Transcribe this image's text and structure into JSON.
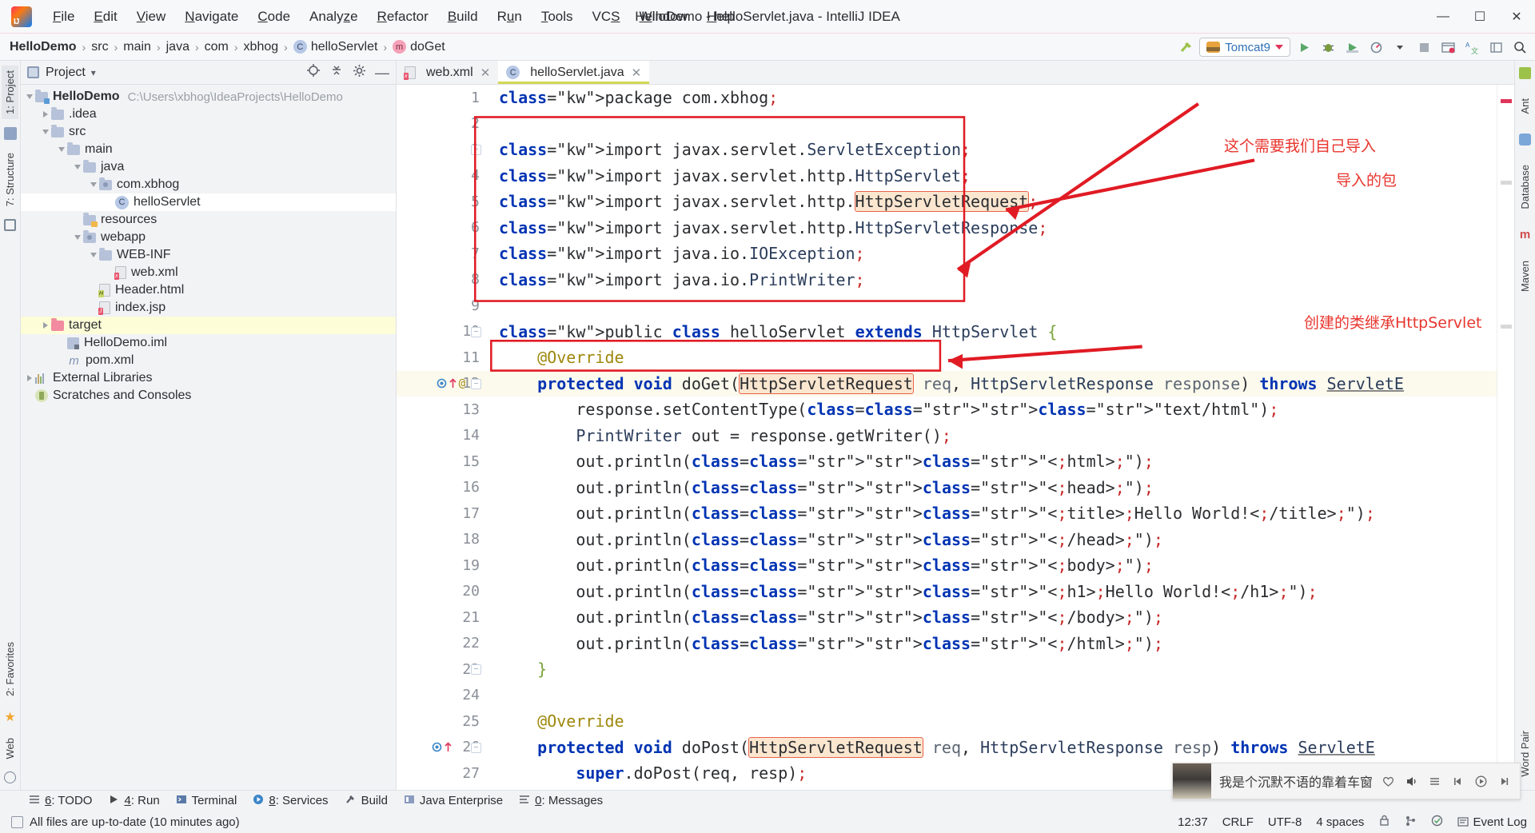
{
  "window": {
    "title": "HelloDemo - helloServlet.java - IntelliJ IDEA",
    "minimize": "—",
    "maximize": "❐",
    "close": "✕"
  },
  "menubar": {
    "items": [
      {
        "label": "File",
        "mnemonic": "F"
      },
      {
        "label": "Edit",
        "mnemonic": "E"
      },
      {
        "label": "View",
        "mnemonic": "V"
      },
      {
        "label": "Navigate",
        "mnemonic": "N"
      },
      {
        "label": "Code",
        "mnemonic": "C"
      },
      {
        "label": "Analyze",
        "mnemonic": "z"
      },
      {
        "label": "Refactor",
        "mnemonic": "R"
      },
      {
        "label": "Build",
        "mnemonic": "B"
      },
      {
        "label": "Run",
        "mnemonic": "u"
      },
      {
        "label": "Tools",
        "mnemonic": "T"
      },
      {
        "label": "VCS",
        "mnemonic": "S"
      },
      {
        "label": "Window",
        "mnemonic": "W"
      },
      {
        "label": "Help",
        "mnemonic": "H"
      }
    ]
  },
  "breadcrumb": {
    "separator": "›",
    "items": [
      {
        "label": "HelloDemo",
        "bold": true,
        "icon": ""
      },
      {
        "label": "src",
        "bold": false,
        "icon": ""
      },
      {
        "label": "main",
        "bold": false,
        "icon": ""
      },
      {
        "label": "java",
        "bold": false,
        "icon": ""
      },
      {
        "label": "com",
        "bold": false,
        "icon": ""
      },
      {
        "label": "xbhog",
        "bold": false,
        "icon": ""
      },
      {
        "label": "helloServlet",
        "bold": false,
        "icon": "class-icon",
        "icon_letter": "C"
      },
      {
        "label": "doGet",
        "bold": false,
        "icon": "method-icon",
        "icon_letter": "m"
      }
    ]
  },
  "toolbar": {
    "run_config": "Tomcat9",
    "run_label": "run-button",
    "debug_label": "debug-button",
    "coverage_label": "run-with-coverage-button",
    "profile_label": "profiler-button",
    "stop_label": "stop-button",
    "updates_label": "updates-button",
    "translate_label": "translate-button",
    "layout_label": "layout-button",
    "search_label": "search-everywhere-button"
  },
  "left_rail": {
    "tabs": [
      {
        "label": "1: Project",
        "selected": true
      },
      {
        "label": "7: Structure",
        "selected": false
      },
      {
        "label": "2: Favorites",
        "selected": false
      },
      {
        "label": "Web",
        "selected": false
      }
    ]
  },
  "right_rail": {
    "tabs": [
      {
        "label": "Ant"
      },
      {
        "label": "Database"
      },
      {
        "label": "Maven"
      },
      {
        "label": "Word Pair"
      }
    ]
  },
  "project_panel": {
    "title": "Project",
    "dropdown_caret": "▾",
    "tree": [
      {
        "depth": 0,
        "arrow": "open",
        "icon": "module-folder-icon",
        "label": "HelloDemo",
        "bold": true,
        "path": "C:\\Users\\xbhog\\IdeaProjects\\HelloDemo",
        "state": "normal"
      },
      {
        "depth": 1,
        "arrow": "closed",
        "icon": "folder-icon",
        "label": ".idea",
        "bold": false,
        "path": "",
        "state": "normal"
      },
      {
        "depth": 1,
        "arrow": "open",
        "icon": "folder-icon",
        "label": "src",
        "bold": false,
        "path": "",
        "state": "normal"
      },
      {
        "depth": 2,
        "arrow": "open",
        "icon": "folder-icon",
        "label": "main",
        "bold": false,
        "path": "",
        "state": "normal"
      },
      {
        "depth": 3,
        "arrow": "open",
        "icon": "folder-source-icon",
        "label": "java",
        "bold": false,
        "path": "",
        "state": "normal"
      },
      {
        "depth": 4,
        "arrow": "open",
        "icon": "package-icon",
        "label": "com.xbhog",
        "bold": false,
        "path": "",
        "state": "normal"
      },
      {
        "depth": 5,
        "arrow": "none",
        "icon": "class-icon",
        "label": "helloServlet",
        "bold": false,
        "path": "",
        "state": "selected"
      },
      {
        "depth": 3,
        "arrow": "none",
        "icon": "folder-resource-icon",
        "label": "resources",
        "bold": false,
        "path": "",
        "state": "normal"
      },
      {
        "depth": 3,
        "arrow": "open",
        "icon": "folder-webapp-icon",
        "label": "webapp",
        "bold": false,
        "path": "",
        "state": "normal"
      },
      {
        "depth": 4,
        "arrow": "open",
        "icon": "folder-icon",
        "label": "WEB-INF",
        "bold": false,
        "path": "",
        "state": "normal"
      },
      {
        "depth": 5,
        "arrow": "none",
        "icon": "xml-file-icon",
        "label": "web.xml",
        "bold": false,
        "path": "",
        "state": "normal"
      },
      {
        "depth": 4,
        "arrow": "none",
        "icon": "html-file-icon",
        "label": "Header.html",
        "bold": false,
        "path": "",
        "state": "normal"
      },
      {
        "depth": 4,
        "arrow": "none",
        "icon": "jsp-file-icon",
        "label": "index.jsp",
        "bold": false,
        "path": "",
        "state": "normal"
      },
      {
        "depth": 1,
        "arrow": "closed",
        "icon": "target-folder-icon",
        "label": "target",
        "bold": false,
        "path": "",
        "state": "highlight"
      },
      {
        "depth": 2,
        "arrow": "none",
        "icon": "iml-file-icon",
        "label": "HelloDemo.iml",
        "bold": false,
        "path": "",
        "state": "normal"
      },
      {
        "depth": 2,
        "arrow": "none",
        "icon": "maven-file-icon",
        "label": "pom.xml",
        "bold": false,
        "path": "",
        "state": "normal"
      },
      {
        "depth": 0,
        "arrow": "closed",
        "icon": "libraries-icon",
        "label": "External Libraries",
        "bold": false,
        "path": "",
        "state": "normal"
      },
      {
        "depth": 0,
        "arrow": "none",
        "icon": "scratches-icon",
        "label": "Scratches and Consoles",
        "bold": false,
        "path": "",
        "state": "normal"
      }
    ]
  },
  "editor": {
    "tabs": [
      {
        "label": "web.xml",
        "icon": "xml-file-icon",
        "active": false,
        "close": "✕"
      },
      {
        "label": "helloServlet.java",
        "icon": "class-icon",
        "active": true,
        "close": "✕"
      }
    ],
    "line_numbers": [
      "1",
      "2",
      "3",
      "4",
      "5",
      "6",
      "7",
      "8",
      "9",
      "10",
      "11",
      "12",
      "13",
      "14",
      "15",
      "16",
      "17",
      "18",
      "19",
      "20",
      "21",
      "22",
      "23",
      "24",
      "25",
      "26",
      "27"
    ],
    "lines": [
      "package com.xbhog;",
      "",
      "import javax.servlet.ServletException;",
      "import javax.servlet.http.HttpServlet;",
      "import javax.servlet.http.HttpServletRequest;",
      "import javax.servlet.http.HttpServletResponse;",
      "import java.io.IOException;",
      "import java.io.PrintWriter;",
      "",
      "public class helloServlet extends HttpServlet {",
      "    @Override",
      "    protected void doGet(HttpServletRequest req, HttpServletResponse response) throws ServletE",
      "        response.setContentType(\"text/html\");",
      "        PrintWriter out = response.getWriter();",
      "        out.println(\"<html>\");",
      "        out.println(\"<head>\");",
      "        out.println(\"<title>Hello World!</title>\");",
      "        out.println(\"</head>\");",
      "        out.println(\"<body>\");",
      "        out.println(\"<h1>Hello World!</h1>\");",
      "        out.println(\"</body>\");",
      "        out.println(\"</html>\");",
      "    }",
      "",
      "    @Override",
      "    protected void doPost(HttpServletRequest req, HttpServletResponse resp) throws ServletE",
      "        super.doPost(req, resp);"
    ]
  },
  "annotations": [
    {
      "id": "note-import-manually",
      "text": "这个需要我们自己导入"
    },
    {
      "id": "note-imported-package",
      "text": "导入的包"
    },
    {
      "id": "note-extends-httpservlet",
      "text": "创建的类继承HttpServlet"
    }
  ],
  "bottom_bar": {
    "items": [
      {
        "label": "6: TODO",
        "mnemonic": "6",
        "icon": "todo-icon"
      },
      {
        "label": "4: Run",
        "mnemonic": "4",
        "icon": "run-icon"
      },
      {
        "label": "Terminal",
        "mnemonic": "",
        "icon": "terminal-icon"
      },
      {
        "label": "8: Services",
        "mnemonic": "8",
        "icon": "services-icon"
      },
      {
        "label": "Build",
        "mnemonic": "",
        "icon": "build-icon"
      },
      {
        "label": "Java Enterprise",
        "mnemonic": "",
        "icon": "java-enterprise-icon"
      },
      {
        "label": "0: Messages",
        "mnemonic": "0",
        "icon": "messages-icon"
      }
    ]
  },
  "status_bar": {
    "message": "All files are up-to-date (10 minutes ago)",
    "caret": "12:37",
    "line_separator": "CRLF",
    "encoding": "UTF-8",
    "indent": "4 spaces",
    "event_log": "Event Log",
    "lock_icon": "lock-icon",
    "branch_icon": "git-branch-icon",
    "inspection_icon": "inspection-icon"
  },
  "music_widget": {
    "text": "我是个沉默不语的靠着车窗",
    "like_icon": "heart-icon",
    "volume_icon": "volume-icon",
    "playlist_icon": "playlist-icon",
    "prev_icon": "previous-icon",
    "play_icon": "play-icon",
    "next_icon": "next-icon"
  },
  "colors": {
    "accent_red": "#e8352e",
    "tab_underline": "#d2d851",
    "selection": "#fdfdd8",
    "error_bg": "#fbe6d0"
  }
}
